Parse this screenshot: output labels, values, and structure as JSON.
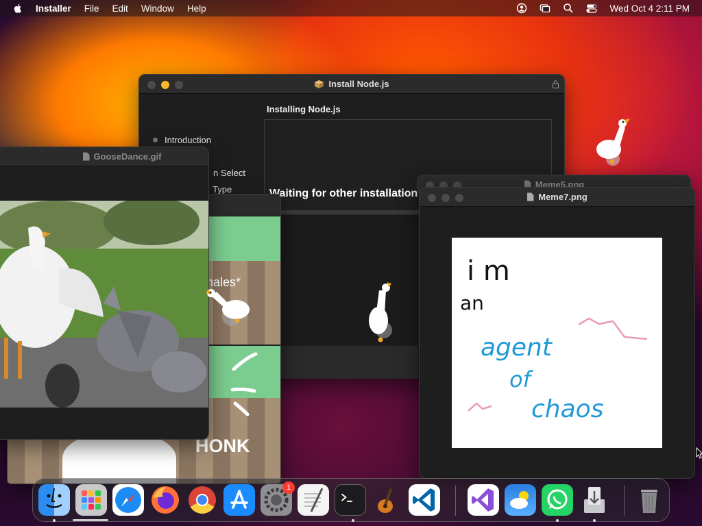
{
  "menubar": {
    "app_name": "Installer",
    "items": [
      "File",
      "Edit",
      "Window",
      "Help"
    ],
    "clock": "Wed Oct 4  2:11 PM"
  },
  "installer": {
    "title": "Install Node.js",
    "steps": [
      "Introduction",
      "n Select",
      "Type"
    ],
    "heading": "Installing Node.js",
    "status": "Waiting for other installation"
  },
  "goosedance": {
    "title": "GooseDance.gif"
  },
  "goose_stripes": {
    "inhales_text": "hales*",
    "honk_text": "HONK"
  },
  "meme5": {
    "title": "Meme5.png"
  },
  "meme7": {
    "title": "Meme7.png",
    "scribble_lines": [
      "i m",
      "an",
      "agent",
      "of",
      "chaos"
    ]
  },
  "dock": {
    "items": [
      {
        "name": "Finder",
        "icon": "finder-icon",
        "running": true
      },
      {
        "name": "Launchpad",
        "icon": "launchpad-icon",
        "running": false
      },
      {
        "name": "Safari",
        "icon": "safari-icon",
        "running": false
      },
      {
        "name": "Firefox",
        "icon": "firefox-icon",
        "running": false
      },
      {
        "name": "Chrome",
        "icon": "chrome-icon",
        "running": false
      },
      {
        "name": "App Store",
        "icon": "app-store-icon",
        "running": false
      },
      {
        "name": "System Settings",
        "icon": "settings-icon",
        "running": false,
        "badge": "1"
      },
      {
        "name": "TextEdit",
        "icon": "textedit-icon",
        "running": false
      },
      {
        "name": "Terminal",
        "icon": "terminal-icon",
        "running": true
      },
      {
        "name": "GarageBand",
        "icon": "garageband-icon",
        "running": false
      },
      {
        "name": "VS Code",
        "icon": "vscode-icon",
        "running": false
      },
      {
        "name": "Visual Studio",
        "icon": "visualstudio-icon",
        "running": false
      },
      {
        "name": "Weather",
        "icon": "weather-icon",
        "running": false
      },
      {
        "name": "WhatsApp",
        "icon": "whatsapp-icon",
        "running": true
      },
      {
        "name": "Installer",
        "icon": "installer-icon",
        "running": true
      },
      {
        "name": "Trash",
        "icon": "trash-icon",
        "running": false
      }
    ]
  },
  "colors": {
    "light_yellow": "#f7b928",
    "meme_black": "#111111",
    "meme_blue": "#1e9ad6",
    "meme_pink": "#e89bb0"
  }
}
